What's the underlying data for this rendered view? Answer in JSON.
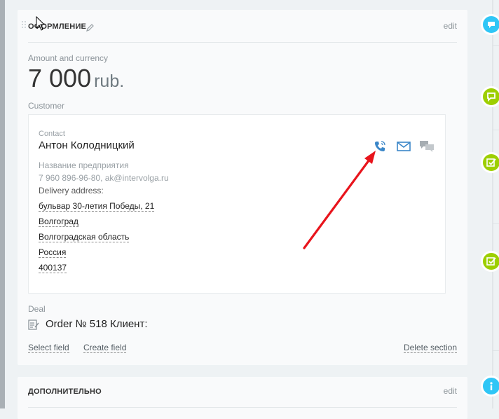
{
  "section_main": {
    "title": "Оформление",
    "edit_label": "edit",
    "amount_label": "Amount and currency",
    "amount_value": "7 000",
    "amount_currency": "rub.",
    "customer_label": "Customer",
    "contact": {
      "label": "Contact",
      "name": "Антон Колодницкий",
      "company": "Название предприятия",
      "phone_email": "7 960 896-96-80, ak@intervolga.ru",
      "delivery_label": "Delivery address:",
      "address_lines": [
        "бульвар 30-летия Победы, 21",
        "Волгоград",
        "Волгоградская область",
        "Россия",
        "400137"
      ]
    },
    "deal_label": "Deal",
    "deal_name": "Order № 518 Клиент:",
    "select_field": "Select field",
    "create_field": "Create field",
    "delete_section": "Delete section"
  },
  "section_additional": {
    "title": "Дополнительно",
    "edit_label": "edit"
  },
  "colors": {
    "accent_blue": "#2fc6f6",
    "accent_green": "#9dcf00",
    "arrow_red": "#e8141c"
  },
  "icons": [
    "drag-handle-icon",
    "pencil-icon",
    "phone-icon",
    "mail-icon",
    "chat-icon",
    "deal-icon",
    "cursor-icon"
  ]
}
